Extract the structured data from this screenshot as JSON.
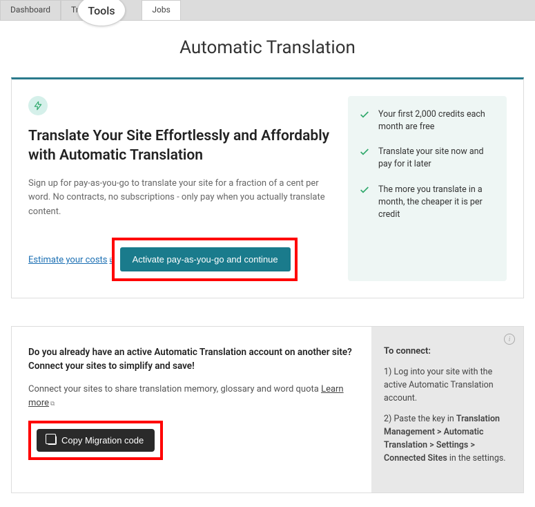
{
  "tabs": {
    "dashboard": "Dashboard",
    "translators": "Transla",
    "jobs": "Jobs"
  },
  "tools_badge": "Tools",
  "page_title": "Automatic Translation",
  "card": {
    "heading": "Translate Your Site Effortlessly and Affordably with Automatic Translation",
    "desc": "Sign up for pay-as-you-go to translate your site for a fraction of a cent per word. No contracts, no subscriptions - only pay when you actually translate content.",
    "estimate_link": "Estimate your costs",
    "activate_btn": "Activate pay-as-you-go and continue"
  },
  "benefits": [
    "Your first 2,000 credits each month are free",
    "Translate your site now and pay for it later",
    "The more you translate in a month, the cheaper it is per credit"
  ],
  "lower": {
    "heading": "Do you already have an active Automatic Translation account on another site? Connect your sites to simplify and save!",
    "desc_pre": "Connect your sites to share translation memory, glossary and word quota ",
    "learn_more": "Learn more",
    "copy_btn": "Copy Migration code"
  },
  "connect": {
    "title": "To connect:",
    "step1": "1) Log into your site with the active Automatic Translation account.",
    "step2_pre": "2) Paste the key in ",
    "step2_path1": "Translation Management > Automatic Translation > Settings > Connected Sites",
    "step2_post": " in the settings."
  }
}
